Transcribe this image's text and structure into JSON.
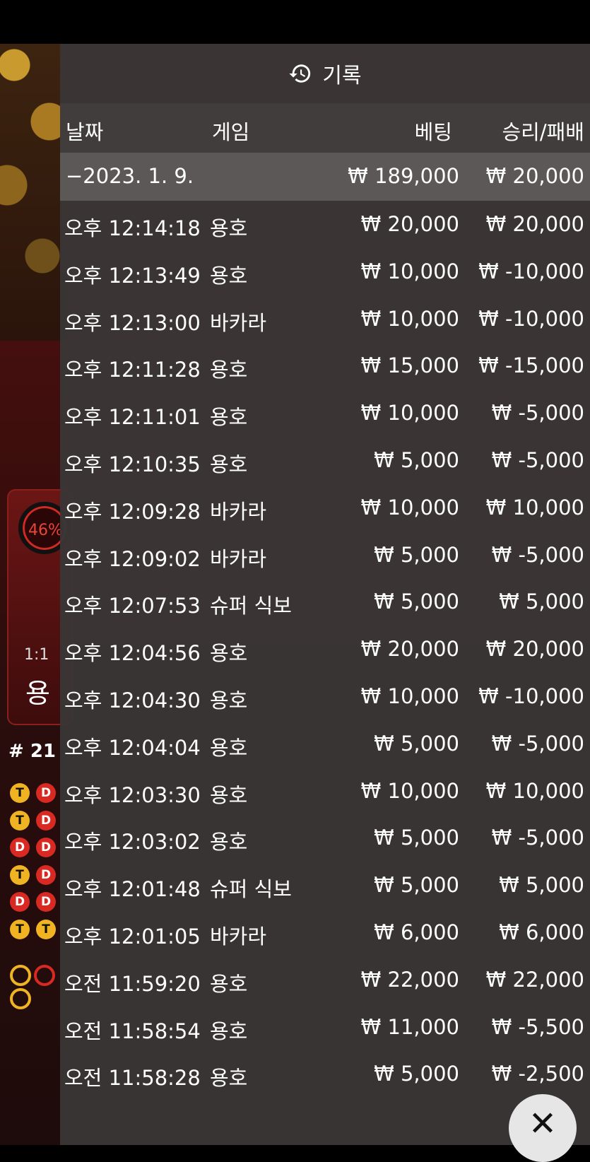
{
  "background": {
    "odds_percent": "46%",
    "ratio": "1:1",
    "bet_label": "용",
    "round": "# 21",
    "roadmap_chips": [
      [
        "T",
        "D"
      ],
      [
        "T",
        "D"
      ],
      [
        "D",
        "D"
      ],
      [
        "T",
        "D"
      ],
      [
        "D",
        "D"
      ],
      [
        "T",
        "T"
      ]
    ]
  },
  "panel": {
    "title": "기록",
    "icon": "history-icon",
    "columns": {
      "date": "날짜",
      "game": "게임",
      "bet": "베팅",
      "result": "승리/패배"
    },
    "date_group": {
      "date": "−2023. 1. 9.",
      "bet_total": "₩ 189,000",
      "result_total": "₩ 20,000"
    },
    "rows": [
      {
        "time": "오후 12:14:18",
        "game": "용호",
        "bet": "₩ 20,000",
        "result": "₩ 20,000"
      },
      {
        "time": "오후 12:13:49",
        "game": "용호",
        "bet": "₩ 10,000",
        "result": "₩ -10,000"
      },
      {
        "time": "오후 12:13:00",
        "game": "바카라",
        "bet": "₩ 10,000",
        "result": "₩ -10,000"
      },
      {
        "time": "오후 12:11:28",
        "game": "용호",
        "bet": "₩ 15,000",
        "result": "₩ -15,000"
      },
      {
        "time": "오후 12:11:01",
        "game": "용호",
        "bet": "₩ 10,000",
        "result": "₩ -5,000"
      },
      {
        "time": "오후 12:10:35",
        "game": "용호",
        "bet": "₩ 5,000",
        "result": "₩ -5,000"
      },
      {
        "time": "오후 12:09:28",
        "game": "바카라",
        "bet": "₩ 10,000",
        "result": "₩ 10,000"
      },
      {
        "time": "오후 12:09:02",
        "game": "바카라",
        "bet": "₩ 5,000",
        "result": "₩ -5,000"
      },
      {
        "time": "오후 12:07:53",
        "game": "슈퍼 식보",
        "bet": "₩ 5,000",
        "result": "₩ 5,000"
      },
      {
        "time": "오후 12:04:56",
        "game": "용호",
        "bet": "₩ 20,000",
        "result": "₩ 20,000"
      },
      {
        "time": "오후 12:04:30",
        "game": "용호",
        "bet": "₩ 10,000",
        "result": "₩ -10,000"
      },
      {
        "time": "오후 12:04:04",
        "game": "용호",
        "bet": "₩ 5,000",
        "result": "₩ -5,000"
      },
      {
        "time": "오후 12:03:30",
        "game": "용호",
        "bet": "₩ 10,000",
        "result": "₩ 10,000"
      },
      {
        "time": "오후 12:03:02",
        "game": "용호",
        "bet": "₩ 5,000",
        "result": "₩ -5,000"
      },
      {
        "time": "오후 12:01:48",
        "game": "슈퍼 식보",
        "bet": "₩ 5,000",
        "result": "₩ 5,000"
      },
      {
        "time": "오후 12:01:05",
        "game": "바카라",
        "bet": "₩ 6,000",
        "result": "₩ 6,000"
      },
      {
        "time": "오전 11:59:20",
        "game": "용호",
        "bet": "₩ 22,000",
        "result": "₩ 22,000"
      },
      {
        "time": "오전 11:58:54",
        "game": "용호",
        "bet": "₩ 11,000",
        "result": "₩ -5,500"
      },
      {
        "time": "오전 11:58:28",
        "game": "용호",
        "bet": "₩ 5,000",
        "result": "₩ -2,500"
      }
    ],
    "close_icon": "close-icon"
  }
}
